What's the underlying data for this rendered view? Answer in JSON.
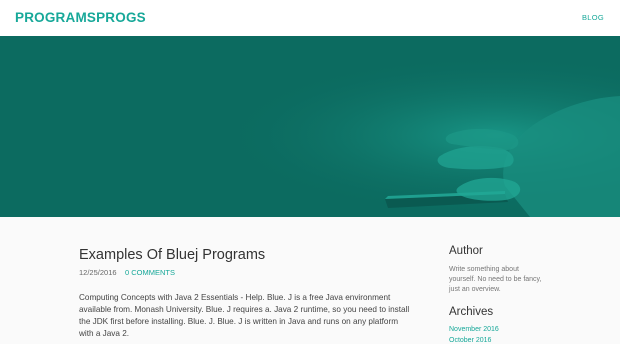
{
  "header": {
    "logo": "PROGRAMSPROGS",
    "nav": [
      {
        "label": "BLOG"
      }
    ]
  },
  "hero": {
    "background_color": "#0c6b60"
  },
  "post": {
    "title": "Examples Of Bluej Programs",
    "date": "12/25/2016",
    "comments": "0 COMMENTS",
    "excerpt": "Computing Concepts with Java 2 Essentials - Help. Blue. J is a free Java environment available from. Monash University. Blue. J requires a. Java 2 runtime, so you need to install the JDK first before installing. Blue. J. Blue. J is written in Java and runs on any platform with a Java 2."
  },
  "sidebar": {
    "author": {
      "heading": "Author",
      "text": "Write something about yourself. No need to be fancy, just an overview."
    },
    "archives": {
      "heading": "Archives",
      "items": [
        {
          "label": "November 2016"
        },
        {
          "label": "October 2016"
        }
      ]
    }
  },
  "colors": {
    "accent": "#17a899",
    "hero": "#0c6b60"
  }
}
